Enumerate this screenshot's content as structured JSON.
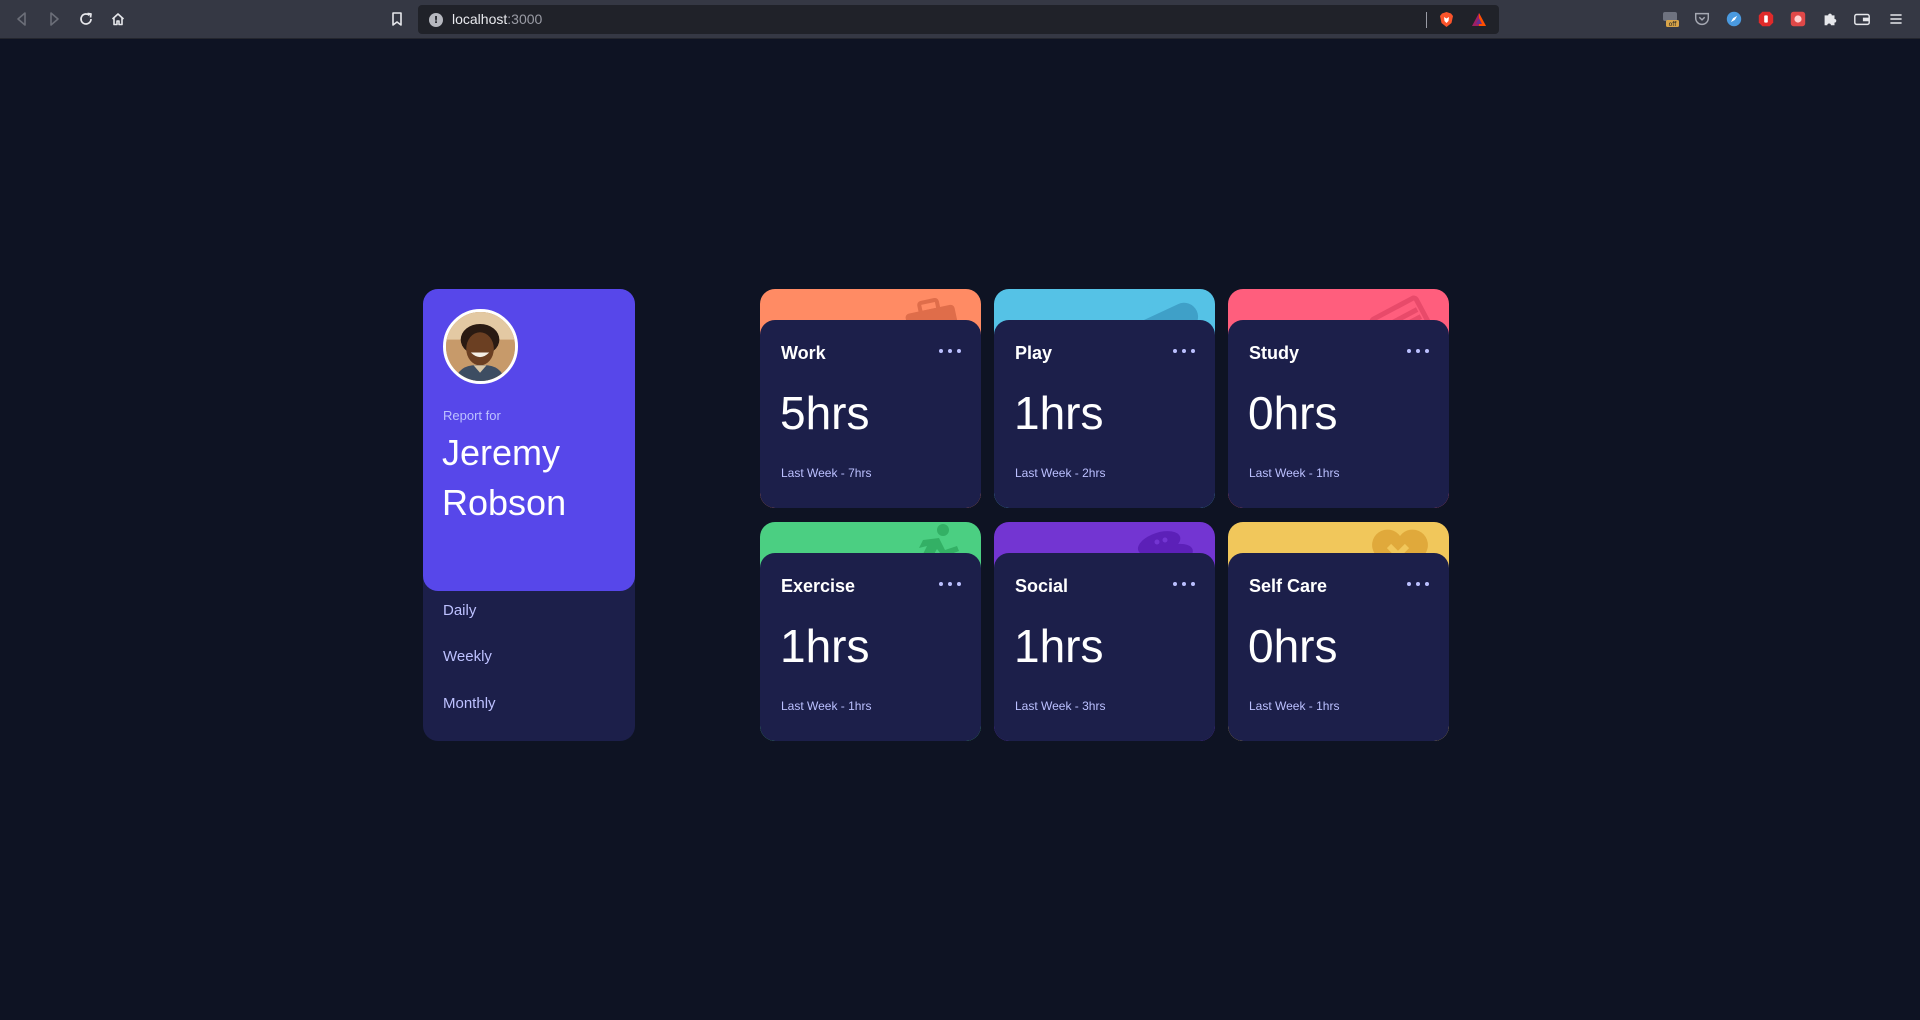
{
  "browser": {
    "url_host": "localhost",
    "url_port": ":3000",
    "info_glyph": "!"
  },
  "profile": {
    "report_for": "Report for",
    "name": "Jeremy Robson",
    "periods": [
      "Daily",
      "Weekly",
      "Monthly"
    ]
  },
  "cards": [
    {
      "title": "Work",
      "hours": "5hrs",
      "last": "Last Week - 7hrs",
      "color": "#ff8b64",
      "icon": "briefcase-icon"
    },
    {
      "title": "Play",
      "hours": "1hrs",
      "last": "Last Week - 2hrs",
      "color": "#55c2e6",
      "icon": "gamepad-icon"
    },
    {
      "title": "Study",
      "hours": "0hrs",
      "last": "Last Week - 1hrs",
      "color": "#ff5e7d",
      "icon": "book-icon"
    },
    {
      "title": "Exercise",
      "hours": "1hrs",
      "last": "Last Week - 1hrs",
      "color": "#4bcf82",
      "icon": "runner-icon"
    },
    {
      "title": "Social",
      "hours": "1hrs",
      "last": "Last Week - 3hrs",
      "color": "#7335d2",
      "icon": "chat-icon"
    },
    {
      "title": "Self Care",
      "hours": "0hrs",
      "last": "Last Week - 1hrs",
      "color": "#f1c75b",
      "icon": "heart-icon"
    }
  ]
}
